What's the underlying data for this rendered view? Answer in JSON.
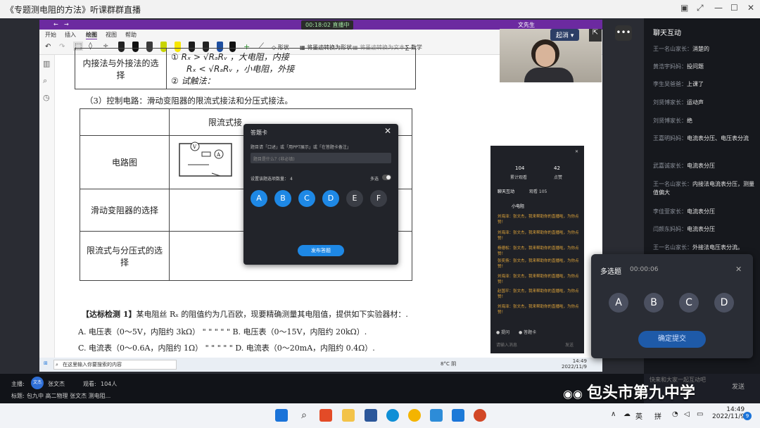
{
  "window": {
    "title": "《专题测电阻的方法》听课群群直播"
  },
  "inner": {
    "time_pill": "00:18:02 直播中",
    "user": "文先生",
    "tabs": [
      "开始",
      "插入",
      "绘图",
      "视图",
      "帮助"
    ],
    "tools": {
      "shape": "形状",
      "ink_shape": "将墨迹转换为形状",
      "ink_text": "将墨迹转换为文本",
      "math": "数学"
    }
  },
  "doc": {
    "row1_label": "内接法与外接法的选择",
    "hw1": "① Rₓ > √RₐRᵥ ，大电阻，内接",
    "hw2": "Rₓ < √RₐRᵥ ，小电阻，外接",
    "hw3": "② 试触法：",
    "section": "（3）控制电路：滑动变阻器的限流式接法和分压式接法。",
    "col_header": "限流式接",
    "r1": "电路图",
    "r2": "滑动变阻器的选择",
    "r3": "限流式与分压式的选择",
    "q_title": "【达标检测 1】",
    "q_text": "某电阻丝 Rₓ 的阻值约为几百欧，现要精确测量其电阻值，提供如下实验器材：.",
    "qa": "A. 电压表（0～5V，内阻约 3kΩ）",
    "qb": "B. 电压表（0～15V，内阻约 20kΩ）.",
    "qc": "C. 电流表（0～0.6A，内阻约 1Ω）",
    "qd": "D. 电流表（0～20mA，内阻约 0.4Ω）.",
    "dots": "\" \" \" \" \""
  },
  "cam": {
    "btn": "起消"
  },
  "dialog": {
    "title": "答题卡",
    "hint": "题目请「口述」或「用PPT展示」或「在答题卡备注」",
    "placeholder": "题目是什么？(非必填)",
    "count_label": "设置该题选项数量：",
    "count": "4",
    "multi": "多选",
    "options": [
      "A",
      "B",
      "C",
      "D",
      "E",
      "F"
    ],
    "publish": "发布答题"
  },
  "mini": {
    "s1": "104",
    "s1l": "累计观看",
    "s2": "42",
    "s2l": "点赞",
    "tab1": "聊天互动",
    "tab2": "观看 105",
    "sys": "小电阻",
    "msgs": [
      "刘海泽：张文杰，我来帮助你的直播啦，为你点赞！",
      "刘海泽：张文杰，我来帮助你的直播啦，为你点赞！",
      "杨德松：张文杰，我来帮助你的直播啦，为你点赞！",
      "张奕扬：张文杰，我来帮助你的直播啦，为你点赞！",
      "刘海泽：张文杰，我来帮助你的直播啦，为你点赞！",
      "赵国平：张文杰，我来帮助你的直播啦，为你点赞！",
      "刘海泽：张文杰，我来帮助你的直播啦，为你点赞！"
    ],
    "b1": "提问",
    "b2": "答题卡",
    "input": "请输入消息",
    "send": "发送"
  },
  "chat": {
    "title": "聊天互动",
    "items": [
      {
        "who": "王一名山家长：",
        "txt": "消楚的"
      },
      {
        "who": "黄浩宇妈妈：",
        "txt": "投问题"
      },
      {
        "who": "李生吴爸爸：",
        "txt": "上课了"
      },
      {
        "who": "刘贤博家长：",
        "txt": "运动声"
      },
      {
        "who": "刘贤博家长：",
        "txt": "绝"
      },
      {
        "who": "王嘉明妈妈：",
        "txt": "电流表分压、电压表分流"
      },
      {
        "who": "武嘉诚家长：",
        "txt": "电流表分压"
      },
      {
        "who": "王一名山家长：",
        "txt": "内接法电流表分压，测量值偏大"
      },
      {
        "who": "李佳萱家长：",
        "txt": "电流表分压"
      },
      {
        "who": "闫颜东妈妈：",
        "txt": "电流表分压"
      },
      {
        "who": "王一名山家长：",
        "txt": "外接法电压表分流。"
      }
    ],
    "input": "快来和大家一起互动吧",
    "send": "发送"
  },
  "multi": {
    "title": "多选题",
    "timer": "00:00:06",
    "options": [
      "A",
      "B",
      "C",
      "D"
    ],
    "submit": "确定提交"
  },
  "taskbar_inner": {
    "search": "在这里输入你要搜索的内容",
    "weather": "8°C 阴",
    "time": "14:49",
    "date": "2022/11/9"
  },
  "bottom": {
    "host_label": "主播:",
    "host": "张文杰",
    "avatar": "文杰",
    "views_label": "观看:",
    "views": "104人",
    "title_label": "标题:",
    "title": "包九中 高二物理 张文杰 测电阻..."
  },
  "watermark": "包头市第九中学",
  "tray": {
    "lang": "英",
    "ime": "拼",
    "time": "14:49",
    "date": "2022/11/9",
    "badge": "9"
  }
}
